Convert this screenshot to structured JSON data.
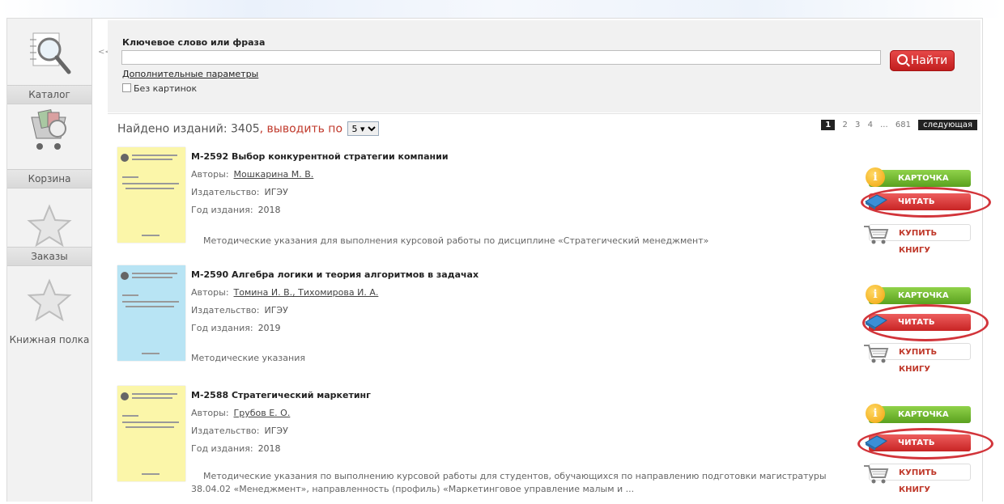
{
  "sidebar": {
    "collapse": "<<",
    "items": [
      {
        "label": "Каталог"
      },
      {
        "label": "Корзина"
      },
      {
        "label": "Заказы"
      },
      {
        "label": "Книжная полка"
      }
    ]
  },
  "search": {
    "label": "Ключевое слово или фраза",
    "value": "",
    "advanced": "Дополнительные параметры",
    "no_pictures": "Без картинок",
    "find_button": "Найти"
  },
  "results": {
    "found_label": "Найдено изданий:",
    "found_count": "3405",
    "per_page_label": ", выводить по",
    "per_page_value": "5 ▾",
    "pagination": {
      "pages": [
        "1",
        "2",
        "3",
        "4",
        "...",
        "681"
      ],
      "current": "1",
      "next": "следующая"
    }
  },
  "labels": {
    "authors": "Авторы:",
    "publisher": "Издательство:",
    "year": "Год издания:"
  },
  "buttons": {
    "card": "КАРТОЧКА",
    "read": "ЧИТАТЬ",
    "buy": "КУПИТЬ КНИГУ"
  },
  "books": [
    {
      "title": "М-2592 Выбор конкурентной стратегии компании",
      "authors": "Мошкарина М. В.",
      "publisher": "ИГЭУ",
      "year": "2018",
      "description": "Методические указания для выполнения курсовой работы по дисциплине «Стратегический менеджмент»",
      "description2": "",
      "cover_color": "#fbf6a9"
    },
    {
      "title": "М-2590 Алгебра логики и теория алгоритмов в задачах",
      "authors": "Томина И. В., Тихомирова И. А.",
      "publisher": "ИГЭУ",
      "year": "2019",
      "description": "Методические указания",
      "description2": "",
      "cover_color": "#b8e4f4"
    },
    {
      "title": "М-2588 Стратегический маркетинг",
      "authors": "Грубов Е. О.",
      "publisher": "ИГЭУ",
      "year": "2018",
      "description": "Методические указания по выполнению курсовой работы для студентов, обучающихся по направлению подготовки магистратуры",
      "description2": "38.04.02 «Менеджмент», направленность (профиль) «Маркетинговое управление малым и ...",
      "cover_color": "#fbf6a9"
    }
  ],
  "colors": {
    "accent_red": "#c01c1c",
    "card_green": "#5aa11f",
    "highlight_ring": "#d2343a"
  }
}
